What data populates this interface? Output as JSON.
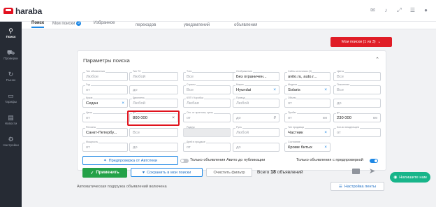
{
  "brand": {
    "name": "haraba"
  },
  "topbar": {
    "icons": [
      "chat-icon",
      "bell-icon",
      "expand-icon",
      "settings-icon",
      "user-icon"
    ]
  },
  "sidebar": {
    "items": [
      {
        "icon": "search-icon",
        "label": "Поиск",
        "active": true
      },
      {
        "icon": "check-icon",
        "label": "Проверки",
        "active": false
      },
      {
        "icon": "market-icon",
        "label": "Рынок",
        "active": false
      },
      {
        "icon": "card-icon",
        "label": "Тарифы",
        "active": false
      },
      {
        "icon": "news-icon",
        "label": "Новости",
        "active": false
      },
      {
        "icon": "gear-icon",
        "label": "Настройки",
        "active": false
      }
    ]
  },
  "tabs": [
    {
      "label": "Поиск",
      "active": true
    },
    {
      "label": "Мои поиски",
      "count": "3"
    },
    {
      "label": "Избранное"
    },
    {
      "label": "переходов"
    },
    {
      "label": "уведомлений"
    },
    {
      "label": "объявления"
    }
  ],
  "my_searches_button": "Мои поиски (1 из 3)",
  "panel": {
    "title": "Параметры поиска"
  },
  "fields": {
    "r1": [
      {
        "label": "Тип объявления",
        "placeholder": "Любое"
      },
      {
        "label": "Тип ТС",
        "placeholder": "Любой"
      },
      {
        "label": "Тэги",
        "placeholder": "Все"
      },
      {
        "label": "Отображение",
        "value": "Без ограничен..."
      },
      {
        "label": "Сайты источники (3)",
        "value": "avito.ru, auto.r..."
      },
      {
        "label": "Цвета",
        "placeholder": "Все"
      }
    ],
    "r2": [
      {
        "label": "Год",
        "placeholder": "от"
      },
      {
        "placeholder": "до"
      },
      {
        "label": "Страны",
        "placeholder": "Все"
      },
      {
        "label": "Марка",
        "value": "Hyundai"
      },
      {
        "label": "Модели",
        "value": "Solaris"
      },
      {
        "label": "Поколения",
        "placeholder": "Все"
      }
    ],
    "r3": [
      {
        "label": "Кузов",
        "value": "Седан"
      },
      {
        "label": "Двигатель",
        "placeholder": "Любой"
      },
      {
        "label": "КПП / Коробка",
        "placeholder": "Любая"
      },
      {
        "label": "Привод",
        "placeholder": "Любой"
      },
      {
        "label": "Объем",
        "placeholder": "от"
      },
      {
        "placeholder": "до"
      }
    ],
    "r4": [
      {
        "label": "Цена",
        "placeholder": "от"
      },
      {
        "label": "до",
        "value": "800 000"
      },
      {
        "label": "Отк. от прогноза, цены",
        "placeholder": "от"
      },
      {
        "placeholder": "до",
        "unit": "₽"
      },
      {
        "label": "Пробег",
        "placeholder": "от",
        "unit": "км"
      },
      {
        "label": "до",
        "value": "230 000",
        "unit": "км"
      }
    ],
    "r5": [
      {
        "label": "Регионы",
        "value": "Санкт-Петербу..."
      },
      {
        "placeholder": "Все"
      },
      {
        "label": "Радиус",
        "placeholder": ""
      },
      {
        "label": "Руль",
        "placeholder": "Любой"
      },
      {
        "label": "Тип продавца",
        "value": "Частник"
      },
      {
        "label": "Кол-во владельцев",
        "placeholder": "от"
      }
    ],
    "r6": [
      {
        "label": "Мощность",
        "placeholder": "от"
      },
      {
        "placeholder": "до"
      },
      {
        "label": "Дней в продаже",
        "placeholder": "от"
      },
      {
        "placeholder": "до"
      },
      {
        "label": "Состояние",
        "value": "Кроме битых"
      }
    ]
  },
  "autoteka_button": "Предпроверка от Автотеки",
  "toggles": [
    {
      "label": "Только объявления Авито до публикации",
      "on": false
    },
    {
      "label": "Только объявления с предпроверкой",
      "on": true
    }
  ],
  "actions": {
    "apply": "Применить",
    "save": "Сохранить в мои поиски",
    "clear": "Очистить фильтр"
  },
  "total": {
    "prefix": "Всего",
    "count": "18",
    "suffix": "объявлений"
  },
  "bottom": {
    "autoload": "Автоматическая подгрузка объявлений включена",
    "lenta": "Настройка ленты"
  },
  "chat": "Напишите нам"
}
